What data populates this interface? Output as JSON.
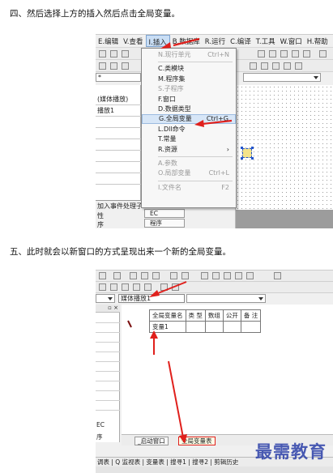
{
  "steps": {
    "step4": "四、然后选择上方的插入然后点击全局变量。",
    "step5": "五、此时就会以新窗口的方式呈现出来一个新的全局变量。"
  },
  "shot1": {
    "menubar": [
      "E.编辑",
      "V.查看",
      "I.插入",
      "B.数据库",
      "R.运行",
      "C.编译",
      "T.工具",
      "W.窗口",
      "H.帮助"
    ],
    "active_menu_index": 2,
    "combo_left": "*",
    "left_panel": {
      "rows": [
        "(媒体播放)",
        "播放1"
      ],
      "bottom_rows": [
        "加入事件处理子",
        "性",
        "序"
      ],
      "tabs": [
        "EC",
        "程序"
      ]
    },
    "insert_menu": [
      {
        "label": "N.现行单元",
        "shortcut": "Ctrl+N",
        "disabled": true
      },
      {
        "sep": true
      },
      {
        "label": "C.类模块",
        "shortcut": "",
        "disabled": false
      },
      {
        "label": "M.程序集",
        "shortcut": "",
        "disabled": false
      },
      {
        "label": "S.子程序",
        "shortcut": "",
        "disabled": true
      },
      {
        "label": "F.窗口",
        "shortcut": "",
        "disabled": false
      },
      {
        "label": "D.数据类型",
        "shortcut": "",
        "disabled": false
      },
      {
        "label": "G.全局变量",
        "shortcut": "Ctrl+G",
        "disabled": false,
        "highlight": true
      },
      {
        "label": "L.Dll命令",
        "shortcut": "",
        "disabled": false
      },
      {
        "label": "T.常量",
        "shortcut": "",
        "disabled": false
      },
      {
        "label": "R.资源",
        "shortcut": "›",
        "disabled": false
      },
      {
        "sep": true
      },
      {
        "label": "A.参数",
        "shortcut": "",
        "disabled": true
      },
      {
        "label": "O.局部变量",
        "shortcut": "Ctrl+L",
        "disabled": true
      },
      {
        "sep": true
      },
      {
        "label": "I.文件名",
        "shortcut": "F2",
        "disabled": true
      }
    ]
  },
  "shot2": {
    "combo_module": "媒体播放1",
    "left_rows": [
      "EC",
      "序"
    ],
    "table_headers": [
      "全局变量名",
      "类 型",
      "数组",
      "公开",
      "备 注"
    ],
    "table_rows": [
      [
        "变量1",
        "",
        "",
        "",
        ""
      ]
    ],
    "tabs": [
      "_启动窗口",
      "全局变量表"
    ],
    "active_tab_index": 1,
    "status": "调表 | Q 监视表 | 变量表 | 搜寻1 | 搜寻2 | 剪辑历史"
  },
  "watermark": "最需教育",
  "colors": {
    "arrow": "#e0201c",
    "menu_highlight": "#d7e6f7",
    "watermark": "#2b3fa8"
  }
}
